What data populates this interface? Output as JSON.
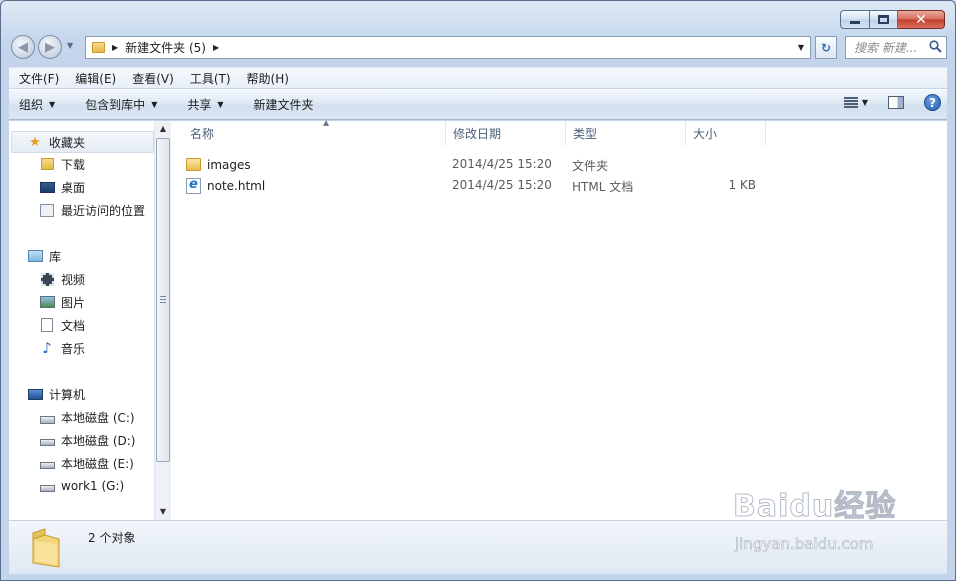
{
  "window": {
    "caption_buttons": {
      "minimize": "",
      "maximize": "",
      "close": "✕"
    }
  },
  "address_bar": {
    "path": "新建文件夹 (5)",
    "search_placeholder": "搜索 新建..."
  },
  "menu": {
    "items": [
      "文件(F)",
      "编辑(E)",
      "查看(V)",
      "工具(T)",
      "帮助(H)"
    ]
  },
  "toolbar": {
    "organize": "组织",
    "include_in_library": "包含到库中",
    "share": "共享",
    "new_folder": "新建文件夹"
  },
  "nav_pane": {
    "favorites": {
      "label": "收藏夹",
      "items": [
        "下载",
        "桌面",
        "最近访问的位置"
      ]
    },
    "libraries": {
      "label": "库",
      "items": [
        "视频",
        "图片",
        "文档",
        "音乐"
      ]
    },
    "computer": {
      "label": "计算机",
      "items": [
        "本地磁盘 (C:)",
        "本地磁盘 (D:)",
        "本地磁盘 (E:)",
        "work1 (G:)"
      ]
    }
  },
  "file_list": {
    "columns": [
      "名称",
      "修改日期",
      "类型",
      "大小"
    ],
    "rows": [
      {
        "name": "images",
        "modified": "2014/4/25 15:20",
        "type": "文件夹",
        "size": "",
        "icon": "folder-icon"
      },
      {
        "name": "note.html",
        "modified": "2014/4/25 15:20",
        "type": "HTML 文档",
        "size": "1 KB",
        "icon": "html-file-icon"
      }
    ]
  },
  "status": {
    "item_count": "2 个对象"
  },
  "watermark": {
    "brand": "Baidu经验",
    "url": "jingyan.baidu.com"
  },
  "colors": {
    "chrome": "#c5d6ec",
    "accent": "#2f6fb7",
    "close_button": "#c23d2b"
  }
}
